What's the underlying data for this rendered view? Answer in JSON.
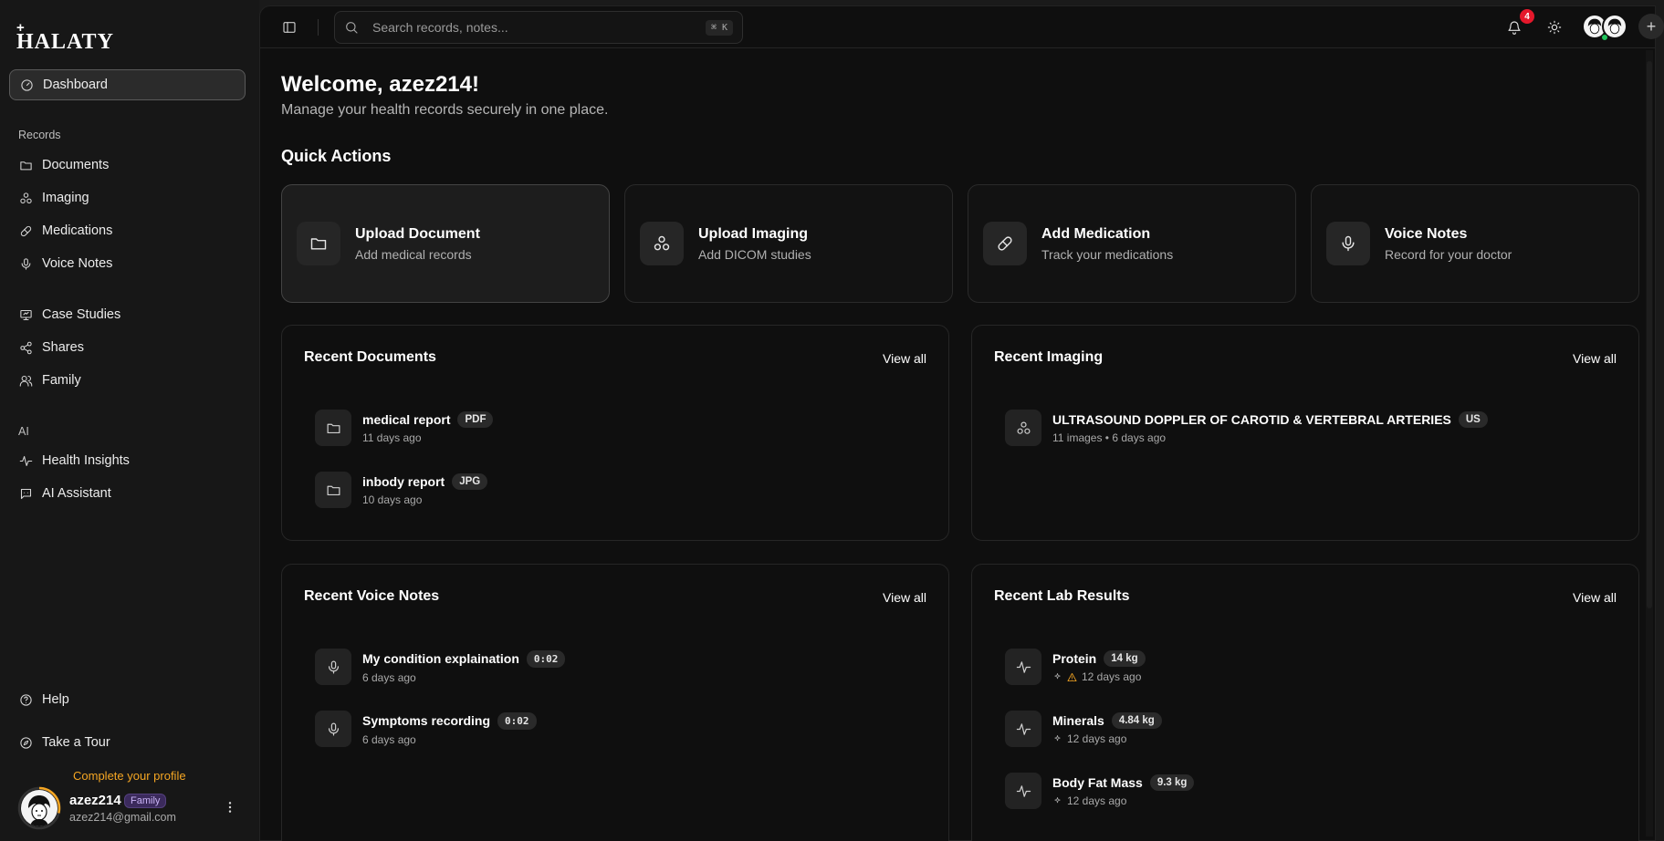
{
  "brand": {
    "plus": "+",
    "name": "HALATY"
  },
  "sidebar": {
    "dashboard": "Dashboard",
    "records_label": "Records",
    "records": [
      "Documents",
      "Imaging",
      "Medications",
      "Voice Notes"
    ],
    "other": [
      "Case Studies",
      "Shares",
      "Family"
    ],
    "ai_label": "AI",
    "ai": [
      "Health Insights",
      "AI Assistant"
    ],
    "help": "Help",
    "tour": "Take a Tour"
  },
  "user": {
    "cta": "Complete your profile",
    "name": "azez214",
    "badge": "Family",
    "email": "azez214@gmail.com"
  },
  "topbar": {
    "search_placeholder": "Search records, notes...",
    "shortcut": "⌘ K",
    "notifications": "4",
    "add": "+"
  },
  "main": {
    "welcome": "Welcome, azez214!",
    "subtitle": "Manage your health records securely in one place.",
    "quick_actions_title": "Quick Actions",
    "quick_actions": [
      {
        "label": "Upload Document",
        "sub": "Add medical records",
        "icon": "folder-icon"
      },
      {
        "label": "Upload Imaging",
        "sub": "Add DICOM studies",
        "icon": "radiation-icon"
      },
      {
        "label": "Add Medication",
        "sub": "Track your medications",
        "icon": "pill-icon"
      },
      {
        "label": "Voice Notes",
        "sub": "Record for your doctor",
        "icon": "mic-icon"
      }
    ]
  },
  "recent_documents": {
    "title": "Recent Documents",
    "view_all": "View all",
    "items": [
      {
        "name": "medical report",
        "tag": "PDF",
        "time": "11 days ago"
      },
      {
        "name": "inbody report",
        "tag": "JPG",
        "time": "10 days ago"
      }
    ]
  },
  "recent_imaging": {
    "title": "Recent Imaging",
    "view_all": "View all",
    "items": [
      {
        "name": "ULTRASOUND DOPPLER OF CAROTID & VERTEBRAL ARTERIES",
        "tag": "US",
        "meta": "11 images • 6 days ago"
      }
    ]
  },
  "recent_voice": {
    "title": "Recent Voice Notes",
    "view_all": "View all",
    "items": [
      {
        "name": "My condition explaination",
        "duration": "0:02",
        "time": "6 days ago"
      },
      {
        "name": "Symptoms recording",
        "duration": "0:02",
        "time": "6 days ago"
      }
    ]
  },
  "recent_labs": {
    "title": "Recent Lab Results",
    "view_all": "View all",
    "items": [
      {
        "name": "Protein",
        "value": "14 kg",
        "time": "12 days ago",
        "warning": true
      },
      {
        "name": "Minerals",
        "value": "4.84 kg",
        "time": "12 days ago",
        "warning": false
      },
      {
        "name": "Body Fat Mass",
        "value": "9.3 kg",
        "time": "12 days ago",
        "warning": false
      }
    ]
  },
  "colors": {
    "accent_warning": "#f5a623",
    "notification": "#e5182b",
    "online": "#21c55d"
  }
}
